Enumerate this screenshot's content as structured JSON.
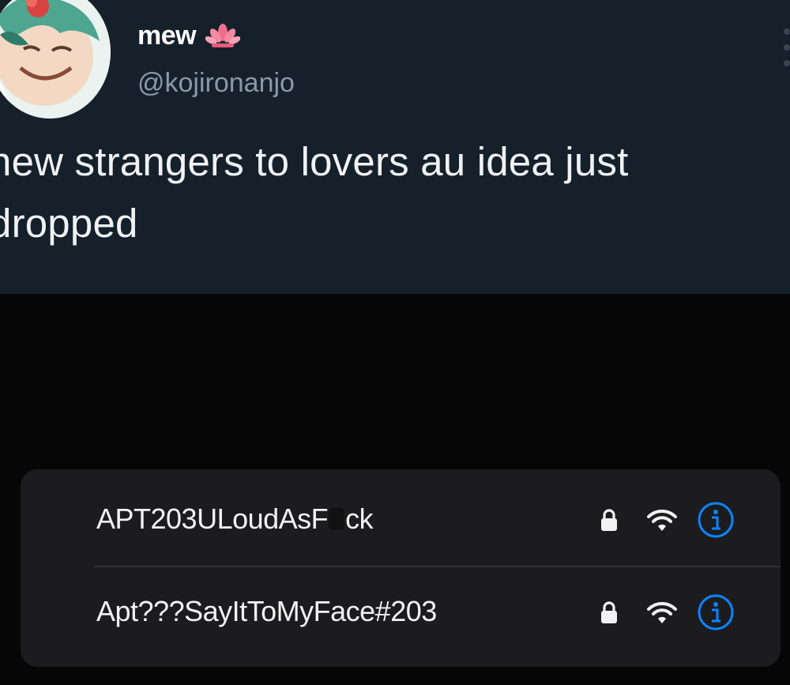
{
  "tweet": {
    "display_name": "mew",
    "handle": "@kojironanjo",
    "text": "new strangers to lovers au idea just dropped"
  },
  "wifi_list": {
    "networks": [
      {
        "ssid_prefix": "APT203ULoudAsF",
        "ssid_suffix": "ck",
        "secured": true
      },
      {
        "ssid": "Apt???SayItToMyFace#203",
        "secured": true
      }
    ]
  },
  "colors": {
    "tweet_bg": "#15202b",
    "name": "#ffffff",
    "handle": "#8b98a5",
    "info_icon": "#0a84ff",
    "list_bg": "#1c1c1e"
  },
  "icons": [
    "avatar-image",
    "lotus-icon",
    "lock-icon",
    "wifi-icon",
    "info-icon"
  ]
}
